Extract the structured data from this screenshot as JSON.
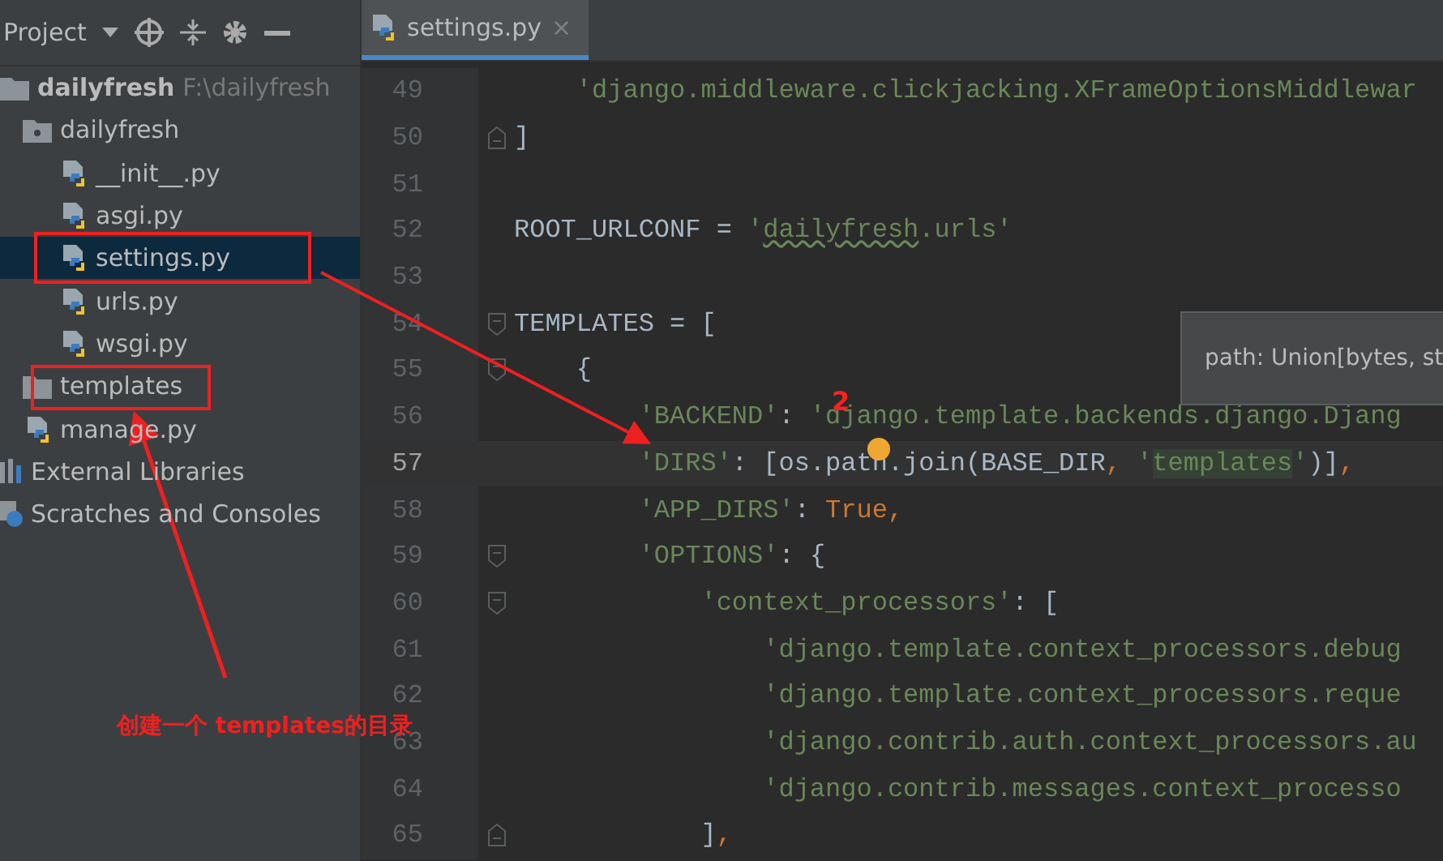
{
  "project_panel": {
    "title": "Project"
  },
  "tree": [
    {
      "name": "dailyfresh",
      "path": "F:\\dailyfresh",
      "kind": "root",
      "selected": false,
      "children": [
        {
          "name": "dailyfresh",
          "kind": "package",
          "selected": false,
          "children": [
            {
              "name": "__init__.py",
              "kind": "python",
              "selected": false
            },
            {
              "name": "asgi.py",
              "kind": "python",
              "selected": false
            },
            {
              "name": "settings.py",
              "kind": "python",
              "selected": true
            },
            {
              "name": "urls.py",
              "kind": "python",
              "selected": false
            },
            {
              "name": "wsgi.py",
              "kind": "python",
              "selected": false
            }
          ]
        },
        {
          "name": "templates",
          "kind": "folder",
          "selected": false
        },
        {
          "name": "manage.py",
          "kind": "python",
          "selected": false
        }
      ]
    },
    {
      "name": "External Libraries",
      "kind": "libraries",
      "selected": false
    },
    {
      "name": "Scratches and Consoles",
      "kind": "scratches",
      "selected": false
    }
  ],
  "tabs": [
    {
      "label": "settings.py",
      "selected": true,
      "close": "×"
    }
  ],
  "code": [
    {
      "number": "49",
      "current": false,
      "tokens": [
        {
          "t": "    'django.middleware.clickjacking.XFrameOptionsMiddlewar",
          "kind": "str"
        }
      ]
    },
    {
      "number": "50",
      "fold_end": true,
      "current": false,
      "tokens": [
        {
          "t": "]",
          "kind": "code"
        }
      ]
    },
    {
      "number": "51",
      "current": false
    },
    {
      "number": "52",
      "current": false,
      "tokens": [
        {
          "t": "ROOT_URLCONF = ",
          "kind": "code"
        },
        {
          "t": "'",
          "kind": "str"
        },
        {
          "t": "dailyfresh",
          "kind": "typo"
        },
        {
          "t": ".urls'",
          "kind": "str"
        }
      ]
    },
    {
      "number": "53",
      "current": false
    },
    {
      "number": "54",
      "fold_start": true,
      "current": false,
      "tokens": [
        {
          "t": "TEMPLATES = [",
          "kind": "code"
        }
      ]
    },
    {
      "number": "55",
      "fold_start": true,
      "current": false,
      "tokens": [
        {
          "t": "    {",
          "kind": "code"
        }
      ]
    },
    {
      "number": "56",
      "current": false,
      "tokens": [
        {
          "t": "        'BACKEND'",
          "kind": "str"
        },
        {
          "t": ": ",
          "kind": "code"
        },
        {
          "t": "'django.template.backends.django.Djang",
          "kind": "str"
        }
      ]
    },
    {
      "number": "57",
      "current": true,
      "tokens": [
        {
          "t": "        'DIRS'",
          "kind": "str"
        },
        {
          "t": ": [os.path.join(BASE_DIR",
          "kind": "code"
        },
        {
          "t": ", ",
          "kind": "kw"
        },
        {
          "t": "'",
          "kind": "str"
        },
        {
          "t": "templates",
          "kind": "match"
        },
        {
          "t": "'",
          "kind": "str"
        },
        {
          "t": ")]",
          "kind": "code"
        },
        {
          "t": ",",
          "kind": "kw"
        }
      ]
    },
    {
      "number": "58",
      "current": false,
      "tokens": [
        {
          "t": "        'APP_DIRS'",
          "kind": "str"
        },
        {
          "t": ": ",
          "kind": "code"
        },
        {
          "t": "True,",
          "kind": "kw"
        }
      ]
    },
    {
      "number": "59",
      "fold_start": true,
      "current": false,
      "tokens": [
        {
          "t": "        'OPTIONS'",
          "kind": "str"
        },
        {
          "t": ": {",
          "kind": "code"
        }
      ]
    },
    {
      "number": "60",
      "fold_start": true,
      "current": false,
      "tokens": [
        {
          "t": "            'context_processors'",
          "kind": "str"
        },
        {
          "t": ": [",
          "kind": "code"
        }
      ]
    },
    {
      "number": "61",
      "current": false,
      "tokens": [
        {
          "t": "                'django.template.context_processors.debug",
          "kind": "str"
        }
      ]
    },
    {
      "number": "62",
      "current": false,
      "tokens": [
        {
          "t": "                'django.template.context_processors.reque",
          "kind": "str"
        }
      ]
    },
    {
      "number": "63",
      "current": false,
      "tokens": [
        {
          "t": "                'django.contrib.auth.context_processors.au",
          "kind": "str"
        }
      ]
    },
    {
      "number": "64",
      "current": false,
      "tokens": [
        {
          "t": "                'django.contrib.messages.context_processo",
          "kind": "str"
        }
      ]
    },
    {
      "number": "65",
      "fold_end": true,
      "current": false,
      "tokens": [
        {
          "t": "            ]",
          "kind": "code"
        },
        {
          "t": ",",
          "kind": "kw"
        }
      ]
    }
  ],
  "tooltip": {
    "text": "path: Union[bytes, st"
  },
  "annotations": {
    "step_label": "2",
    "note": "创建一个 templates的目录"
  }
}
